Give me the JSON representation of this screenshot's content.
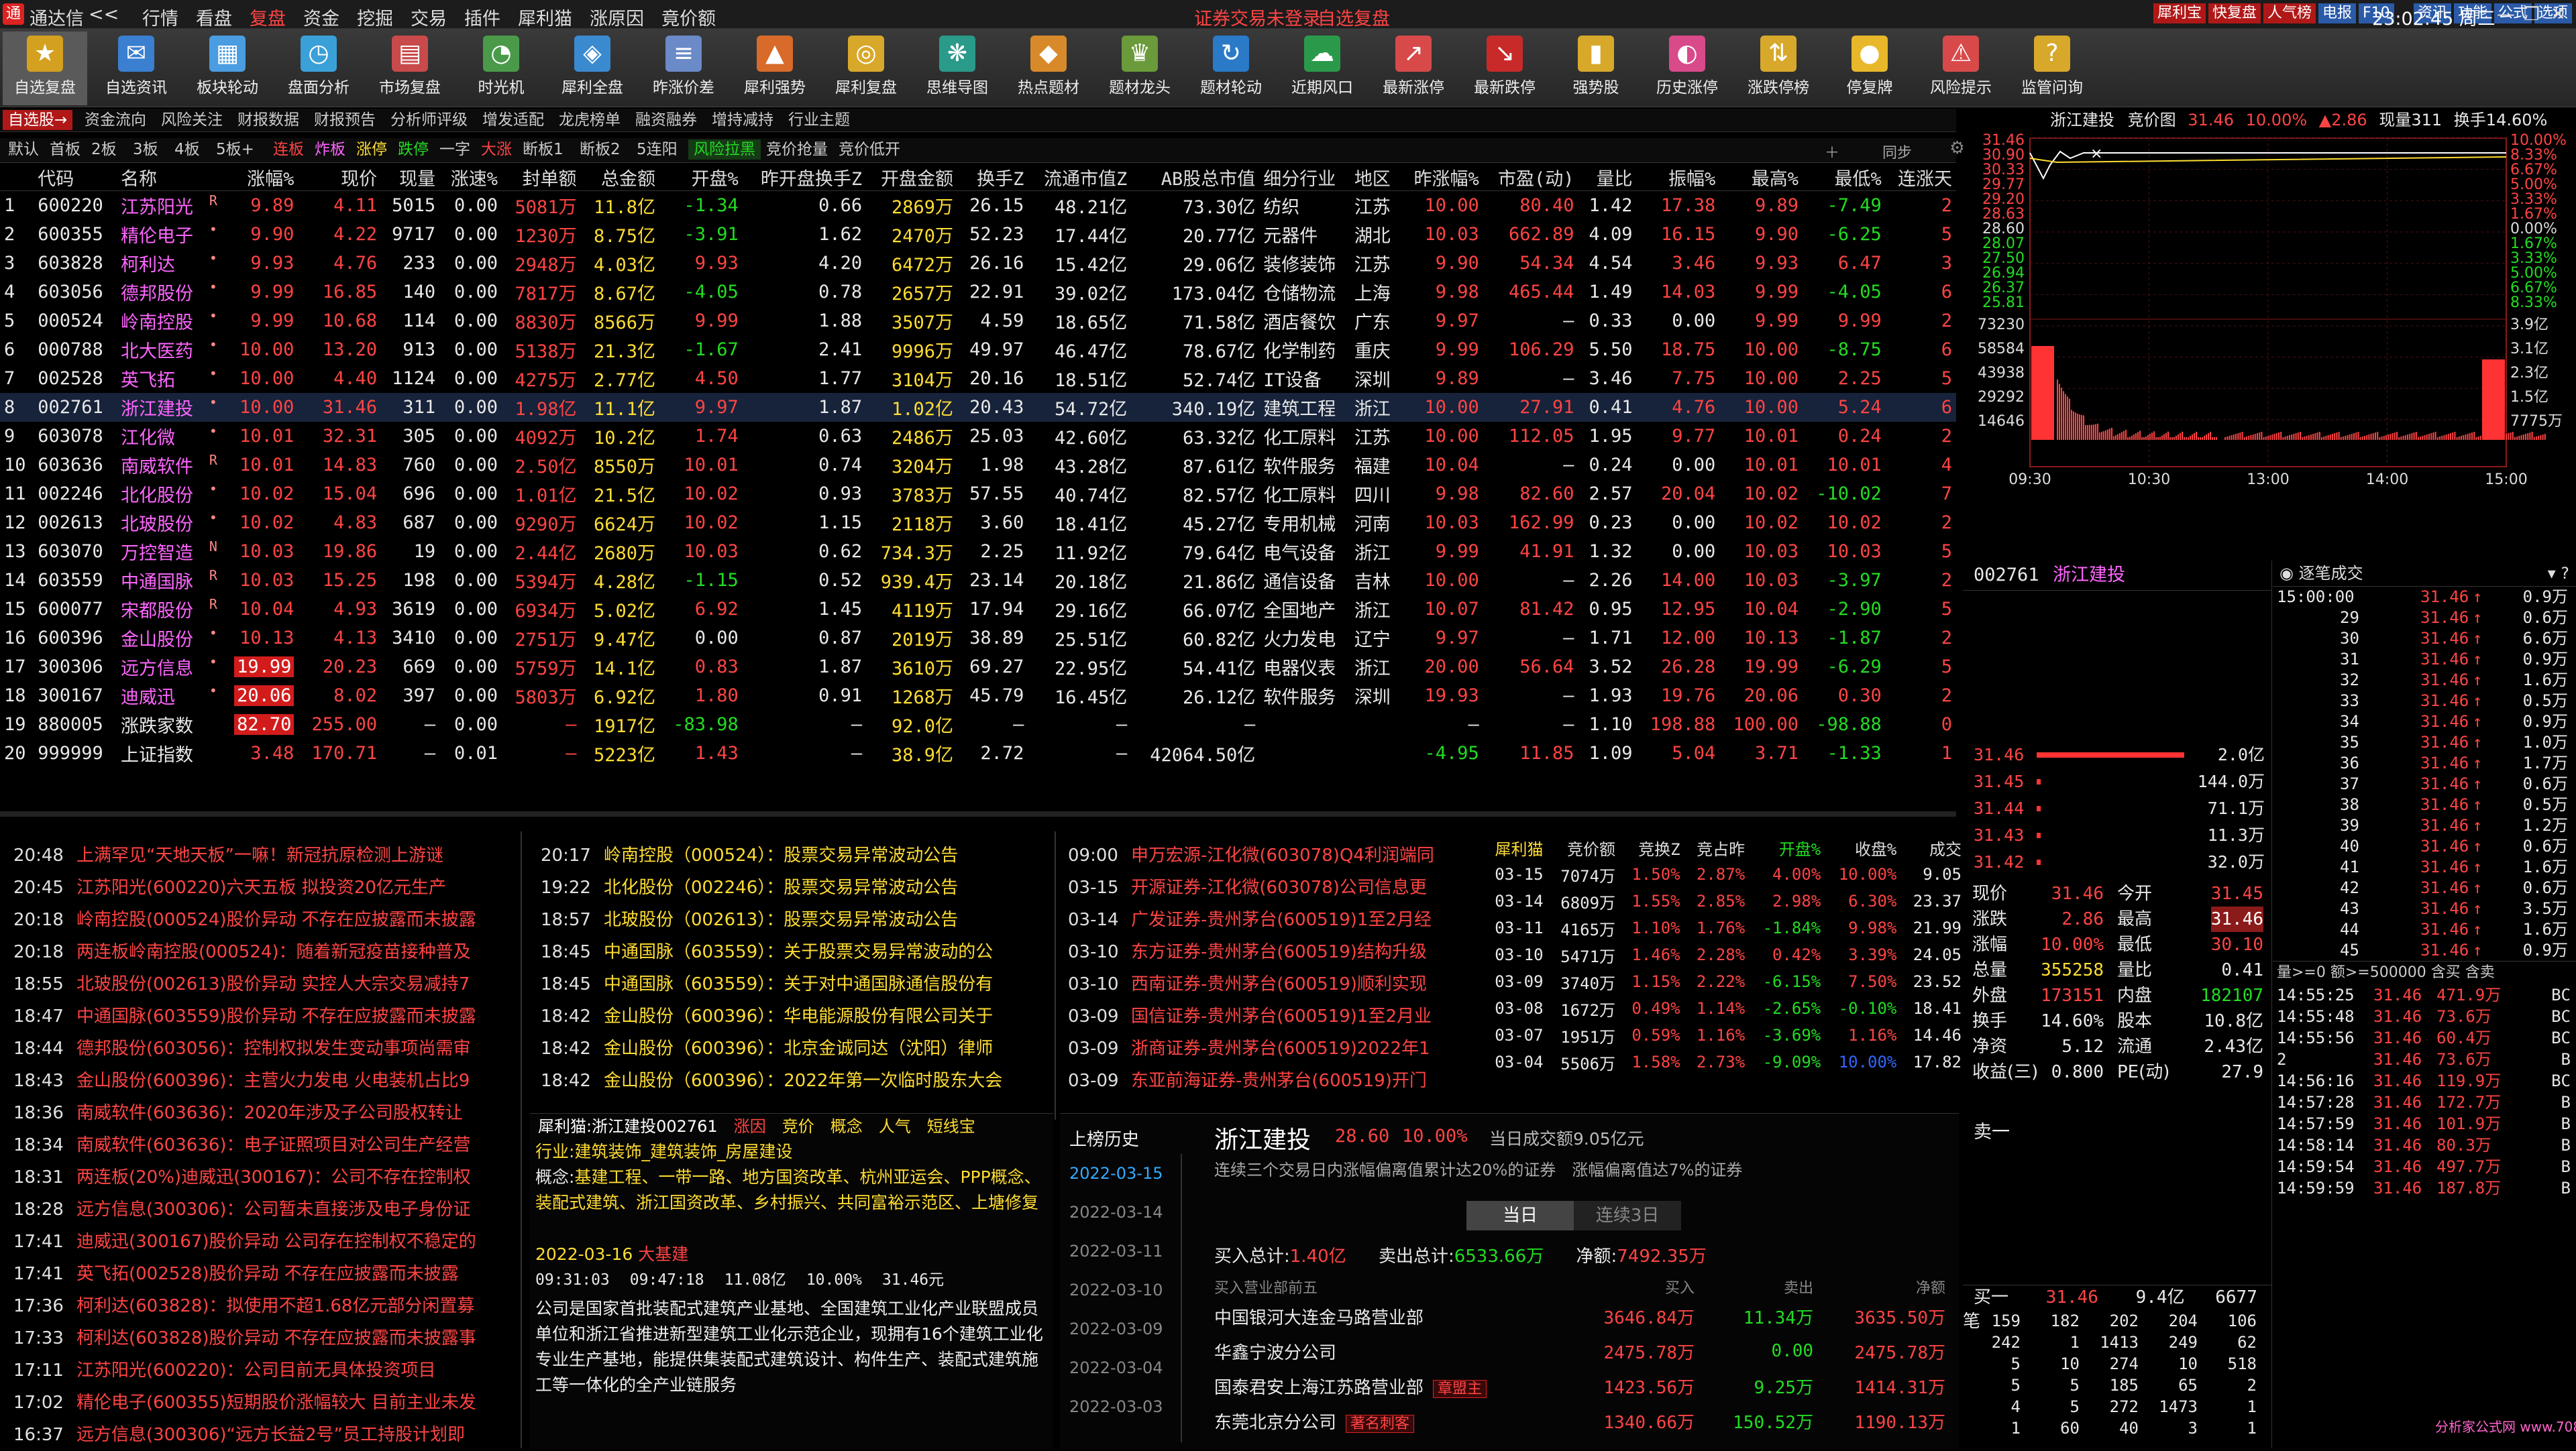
{
  "app": {
    "name": "通达信",
    "nav_back": "<<",
    "menu": [
      "行情",
      "看盘",
      "复盘",
      "资金",
      "挖掘",
      "交易",
      "插件",
      "犀利猫",
      "涨原因",
      "竟价额"
    ],
    "active_menu": "复盘",
    "center_notice": "证券交易未登录",
    "center_link": "自选复盘",
    "right_pills": [
      "犀利宝",
      "快复盘",
      "人气榜",
      "电报",
      "F10",
      "资讯",
      "功能",
      "公式",
      "选项"
    ],
    "clock": "23:02:45 周三"
  },
  "toolbar": [
    "自选复盘",
    "自选资讯",
    "板块轮动",
    "盘面分析",
    "市场复盘",
    "时光机",
    "犀利全盘",
    "昨涨价差",
    "犀利强势",
    "犀利复盘",
    "思维导图",
    "热点题材",
    "题材龙头",
    "题材轮动",
    "近期风口",
    "最新涨停",
    "最新跌停",
    "强势股",
    "历史涨停",
    "涨跌停榜",
    "停复牌",
    "风险提示",
    "监管问询"
  ],
  "tabs1": [
    "自选股→",
    "资金流向",
    "风险关注",
    "财报数据",
    "财报预告",
    "分析师评级",
    "增发适配",
    "龙虎榜单",
    "融资融券",
    "增持减持",
    "行业主题"
  ],
  "tabs2": [
    "默认",
    "首板",
    "2板",
    "3板",
    "4板",
    "5板+",
    "连板",
    "炸板",
    "涨停",
    "跌停",
    "一字",
    "大涨",
    "断板1",
    "断板2",
    "5连阳",
    "风险拉黑",
    "竞价抢量",
    "竞价低开"
  ],
  "sync_label": "同步",
  "columns": [
    "代码",
    "名称",
    "涨幅%",
    "现价",
    "现量",
    "涨速%",
    "封单额",
    "总金额",
    "开盘%",
    "昨开盘换手Z",
    "开盘金额",
    "换手Z",
    "流通市值Z",
    "AB股总市值",
    "细分行业",
    "地区",
    "昨涨幅%",
    "市盈(动)",
    "量比",
    "振幅%",
    "最高%",
    "最低%",
    "连涨天"
  ],
  "rows": [
    [
      "1",
      "600220",
      "江苏阳光",
      "R",
      "9.89",
      "4.11",
      "5015",
      "0.00",
      "5081万",
      "11.8亿",
      "-1.34",
      "0.66",
      "2869万",
      "26.15",
      "48.21亿",
      "73.30亿",
      "纺织",
      "江苏",
      "10.00",
      "80.40",
      "1.42",
      "17.38",
      "9.89",
      "-7.49",
      "2"
    ],
    [
      "2",
      "600355",
      "精伦电子",
      "•",
      "9.90",
      "4.22",
      "9717",
      "0.00",
      "1230万",
      "8.75亿",
      "-3.91",
      "1.62",
      "2470万",
      "52.23",
      "17.44亿",
      "20.77亿",
      "元器件",
      "湖北",
      "10.03",
      "662.89",
      "4.09",
      "16.15",
      "9.90",
      "-6.25",
      "5"
    ],
    [
      "3",
      "603828",
      "柯利达",
      "•",
      "9.93",
      "4.76",
      "233",
      "0.00",
      "2948万",
      "4.03亿",
      "9.93",
      "4.20",
      "6472万",
      "26.16",
      "15.42亿",
      "29.06亿",
      "装修装饰",
      "江苏",
      "9.90",
      "54.34",
      "4.54",
      "3.46",
      "9.93",
      "6.47",
      "3"
    ],
    [
      "4",
      "603056",
      "德邦股份",
      "•",
      "9.99",
      "16.85",
      "140",
      "0.00",
      "7817万",
      "8.67亿",
      "-4.05",
      "0.78",
      "2657万",
      "22.91",
      "39.02亿",
      "173.04亿",
      "仓储物流",
      "上海",
      "9.98",
      "465.44",
      "1.49",
      "14.03",
      "9.99",
      "-4.05",
      "6"
    ],
    [
      "5",
      "000524",
      "岭南控股",
      "•",
      "9.99",
      "10.68",
      "114",
      "0.00",
      "8830万",
      "8566万",
      "9.99",
      "1.88",
      "3507万",
      "4.59",
      "18.65亿",
      "71.58亿",
      "酒店餐饮",
      "广东",
      "9.97",
      "—",
      "0.33",
      "0.00",
      "9.99",
      "9.99",
      "2"
    ],
    [
      "6",
      "000788",
      "北大医药",
      "•",
      "10.00",
      "13.20",
      "913",
      "0.00",
      "5138万",
      "21.3亿",
      "-1.67",
      "2.41",
      "9996万",
      "49.97",
      "46.47亿",
      "78.67亿",
      "化学制药",
      "重庆",
      "9.99",
      "106.29",
      "5.50",
      "18.75",
      "10.00",
      "-8.75",
      "6"
    ],
    [
      "7",
      "002528",
      "英飞拓",
      "•",
      "10.00",
      "4.40",
      "1124",
      "0.00",
      "4275万",
      "2.77亿",
      "4.50",
      "1.77",
      "3104万",
      "20.16",
      "18.51亿",
      "52.74亿",
      "IT设备",
      "深圳",
      "9.89",
      "—",
      "3.46",
      "7.75",
      "10.00",
      "2.25",
      "5"
    ],
    [
      "8",
      "002761",
      "浙江建投",
      "•",
      "10.00",
      "31.46",
      "311",
      "0.00",
      "1.98亿",
      "11.1亿",
      "9.97",
      "1.87",
      "1.02亿",
      "20.43",
      "54.72亿",
      "340.19亿",
      "建筑工程",
      "浙江",
      "10.00",
      "27.91",
      "0.41",
      "4.76",
      "10.00",
      "5.24",
      "6"
    ],
    [
      "9",
      "603078",
      "江化微",
      "•",
      "10.01",
      "32.31",
      "305",
      "0.00",
      "4092万",
      "10.2亿",
      "1.74",
      "0.63",
      "2486万",
      "25.03",
      "42.60亿",
      "63.32亿",
      "化工原料",
      "江苏",
      "10.00",
      "112.05",
      "1.95",
      "9.77",
      "10.01",
      "0.24",
      "2"
    ],
    [
      "10",
      "603636",
      "南威软件",
      "R",
      "10.01",
      "14.83",
      "760",
      "0.00",
      "2.50亿",
      "8550万",
      "10.01",
      "0.74",
      "3204万",
      "1.98",
      "43.28亿",
      "87.61亿",
      "软件服务",
      "福建",
      "10.04",
      "—",
      "0.24",
      "0.00",
      "10.01",
      "10.01",
      "4"
    ],
    [
      "11",
      "002246",
      "北化股份",
      "•",
      "10.02",
      "15.04",
      "696",
      "0.00",
      "1.01亿",
      "21.5亿",
      "10.02",
      "0.93",
      "3783万",
      "57.55",
      "40.74亿",
      "82.57亿",
      "化工原料",
      "四川",
      "9.98",
      "82.60",
      "2.57",
      "20.04",
      "10.02",
      "-10.02",
      "7"
    ],
    [
      "12",
      "002613",
      "北玻股份",
      "•",
      "10.02",
      "4.83",
      "687",
      "0.00",
      "9290万",
      "6624万",
      "10.02",
      "1.15",
      "2118万",
      "3.60",
      "18.41亿",
      "45.27亿",
      "专用机械",
      "河南",
      "10.03",
      "162.99",
      "0.23",
      "0.00",
      "10.02",
      "10.02",
      "2"
    ],
    [
      "13",
      "603070",
      "万控智造",
      "N",
      "10.03",
      "19.86",
      "19",
      "0.00",
      "2.44亿",
      "2680万",
      "10.03",
      "0.62",
      "734.3万",
      "2.25",
      "11.92亿",
      "79.64亿",
      "电气设备",
      "浙江",
      "9.99",
      "41.91",
      "1.32",
      "0.00",
      "10.03",
      "10.03",
      "5"
    ],
    [
      "14",
      "603559",
      "中通国脉",
      "R",
      "10.03",
      "15.25",
      "198",
      "0.00",
      "5394万",
      "4.28亿",
      "-1.15",
      "0.52",
      "939.4万",
      "23.14",
      "20.18亿",
      "21.86亿",
      "通信设备",
      "吉林",
      "10.00",
      "—",
      "2.26",
      "14.00",
      "10.03",
      "-3.97",
      "2"
    ],
    [
      "15",
      "600077",
      "宋都股份",
      "R",
      "10.04",
      "4.93",
      "3619",
      "0.00",
      "6934万",
      "5.02亿",
      "6.92",
      "1.45",
      "4119万",
      "17.94",
      "29.16亿",
      "66.07亿",
      "全国地产",
      "浙江",
      "10.07",
      "81.42",
      "0.95",
      "12.95",
      "10.04",
      "-2.90",
      "5"
    ],
    [
      "16",
      "600396",
      "金山股份",
      "•",
      "10.13",
      "4.13",
      "3410",
      "0.00",
      "2751万",
      "9.47亿",
      "0.00",
      "0.87",
      "2019万",
      "38.89",
      "25.51亿",
      "60.82亿",
      "火力发电",
      "辽宁",
      "9.97",
      "—",
      "1.71",
      "12.00",
      "10.13",
      "-1.87",
      "2"
    ],
    [
      "17",
      "300306",
      "远方信息",
      "•",
      "19.99",
      "20.23",
      "669",
      "0.00",
      "5759万",
      "14.1亿",
      "0.83",
      "1.87",
      "3610万",
      "69.27",
      "22.95亿",
      "54.41亿",
      "电器仪表",
      "浙江",
      "20.00",
      "56.64",
      "3.52",
      "26.28",
      "19.99",
      "-6.29",
      "5"
    ],
    [
      "18",
      "300167",
      "迪威迅",
      "•",
      "20.06",
      "8.02",
      "397",
      "0.00",
      "5803万",
      "6.92亿",
      "1.80",
      "0.91",
      "1268万",
      "45.79",
      "16.45亿",
      "26.12亿",
      "软件服务",
      "深圳",
      "19.93",
      "—",
      "1.93",
      "19.76",
      "20.06",
      "0.30",
      "2"
    ],
    [
      "19",
      "880005",
      "涨跌家数",
      "",
      "82.70",
      "255.00",
      "—",
      "0.00",
      "—",
      "1917亿",
      "-83.98",
      "—",
      "92.0亿",
      "—",
      "—",
      "—",
      "",
      "",
      "—",
      "—",
      "1.10",
      "198.88",
      "100.00",
      "-98.88",
      "0"
    ],
    [
      "20",
      "999999",
      "上证指数",
      "",
      "3.48",
      "170.71",
      "—",
      "0.01",
      "—",
      "5223亿",
      "1.43",
      "—",
      "38.9亿",
      "2.72",
      "—",
      "42064.50亿",
      "",
      "",
      "-4.95",
      "11.85",
      "1.09",
      "5.04",
      "3.71",
      "-1.33",
      "1"
    ]
  ],
  "news1": [
    [
      "20:48",
      "上满罕见“天地天板”一嘛！新冠抗原检测上游谜"
    ],
    [
      "20:45",
      "江苏阳光(600220)六天五板 拟投资20亿元生产"
    ],
    [
      "20:18",
      "岭南控股(000524)股价异动 不存在应披露而未披露"
    ],
    [
      "20:18",
      "两连板岭南控股(000524)：随着新冠疫苗接种普及"
    ],
    [
      "18:55",
      "北玻股份(002613)股价异动 实控人大宗交易减持7"
    ],
    [
      "18:47",
      "中通国脉(603559)股价异动 不存在应披露而未披露"
    ],
    [
      "18:44",
      "德邦股份(603056)：控制权拟发生变动事项尚需审"
    ],
    [
      "18:43",
      "金山股份(600396)：主营火力发电 火电装机占比9"
    ],
    [
      "18:36",
      "南威软件(603636)：2020年涉及子公司股权转让"
    ],
    [
      "18:34",
      "南威软件(603636)：电子证照项目对公司生产经营"
    ],
    [
      "18:31",
      "两连板(20%)迪威迅(300167)：公司不存在控制权"
    ],
    [
      "18:28",
      "远方信息(300306)：公司暂未直接涉及电子身份证"
    ],
    [
      "17:41",
      "迪威迅(300167)股价异动 公司存在控制权不稳定的"
    ],
    [
      "17:41",
      "英飞拓(002528)股价异动 不存在应披露而未披露"
    ],
    [
      "17:36",
      "柯利达(603828)：拟使用不超1.68亿元部分闲置募"
    ],
    [
      "17:33",
      "柯利达(603828)股价异动 不存在应披露而未披露事"
    ],
    [
      "17:11",
      "江苏阳光(600220)：公司目前无具体投资项目"
    ],
    [
      "17:02",
      "精伦电子(600355)短期股价涨幅较大 目前主业未发"
    ],
    [
      "16:37",
      "远方信息(300306)“远方长益2号”员工持股计划即"
    ]
  ],
  "news2": [
    [
      "20:17",
      "岭南控股（000524）：股票交易异常波动公告"
    ],
    [
      "19:22",
      "北化股份（002246）：股票交易异常波动公告"
    ],
    [
      "18:57",
      "北玻股份（002613）：股票交易异常波动公告"
    ],
    [
      "18:45",
      "中通国脉（603559）：关于股票交易异常波动的公"
    ],
    [
      "18:45",
      "中通国脉（603559）：关于对中通国脉通信股份有"
    ],
    [
      "18:42",
      "金山股份（600396）：华电能源股份有限公司关于"
    ],
    [
      "18:42",
      "金山股份（600396）：北京金诚同达（沈阳）律师"
    ],
    [
      "18:42",
      "金山股份（600396）：2022年第一次临时股东大会"
    ]
  ],
  "news3": [
    [
      "09:00",
      "申万宏源-江化微(603078)Q4利润端同"
    ],
    [
      "03-15",
      "开源证券-江化微(603078)公司信息更"
    ],
    [
      "03-14",
      "广发证券-贵州茅台(600519)1至2月经"
    ],
    [
      "03-10",
      "东方证券-贵州茅台(600519)结构升级"
    ],
    [
      "03-10",
      "西南证券-贵州茅台(600519)顺利实现"
    ],
    [
      "03-09",
      "国信证券-贵州茅台(600519)1至2月业"
    ],
    [
      "03-09",
      "浙商证券-贵州茅台(600519)2022年1"
    ],
    [
      "03-09",
      "东亚前海证券-贵州茅台(600519)开门"
    ]
  ],
  "auction": {
    "columns": [
      "犀利猫",
      "竞价额",
      "竞换Z",
      "竞占昨",
      "开盘%",
      "收盘%",
      "成交"
    ],
    "rows": [
      [
        "03-15",
        "7074万",
        "1.50%",
        "2.87%",
        "4.00%",
        "10.00%",
        "9.05"
      ],
      [
        "03-14",
        "6809万",
        "1.55%",
        "2.85%",
        "2.98%",
        "6.30%",
        "23.37"
      ],
      [
        "03-11",
        "4165万",
        "1.10%",
        "1.76%",
        "-1.84%",
        "9.98%",
        "21.99"
      ],
      [
        "03-10",
        "5471万",
        "1.46%",
        "2.28%",
        "0.42%",
        "3.39%",
        "24.05"
      ],
      [
        "03-09",
        "3740万",
        "1.15%",
        "2.22%",
        "-6.15%",
        "7.50%",
        "23.52"
      ],
      [
        "03-08",
        "1672万",
        "0.49%",
        "1.14%",
        "-2.65%",
        "-0.10%",
        "18.41"
      ],
      [
        "03-07",
        "1951万",
        "0.59%",
        "1.16%",
        "-3.69%",
        "1.16%",
        "14.46"
      ],
      [
        "03-04",
        "5506万",
        "1.58%",
        "2.73%",
        "-9.09%",
        "10.00%",
        "17.82"
      ]
    ]
  },
  "concept": {
    "tabs": [
      "犀利猫:浙江建投002761",
      "涨因",
      "竞价",
      "概念",
      "人气",
      "短线宝"
    ],
    "industry_label": "行业:",
    "industry": "建筑装饰_建筑装饰_房屋建设",
    "concept_label": "概念:",
    "concepts": "基建工程、一带一路、地方国资改革、杭州亚运会、PPP概念、装配式建筑、浙江国资改革、乡村振兴、共同富裕示范区、上塘修复",
    "date": "2022-03-16",
    "tag": "大基建",
    "times": [
      "09:31:03",
      "09:47:18",
      "11.08亿",
      "10.00%",
      "31.46元"
    ],
    "desc": "公司是国家首批装配式建筑产业基地、全国建筑工业化产业联盟成员单位和浙江省推进新型建筑工业化示范企业，现拥有16个建筑工业化专业生产基地，能提供集装配式建筑设计、构件生产、装配式建筑施工等一体化的全产业链服务"
  },
  "lhb": {
    "history_label": "上榜历史",
    "dates": [
      "2022-03-15",
      "2022-03-14",
      "2022-03-11",
      "2022-03-10",
      "2022-03-09",
      "2022-03-04",
      "2022-03-03"
    ],
    "stock": "浙江建投",
    "price": "28.60",
    "pct": "10.00%",
    "turnover": "当日成交额9.05亿元",
    "reason": "连续三个交易日内涨幅偏离值累计达20%的证券　涨幅偏离值达7%的证券",
    "tab_today": "当日",
    "tab_3d": "连续3日",
    "buy_total_label": "买入总计:",
    "buy_total": "1.40亿",
    "sell_total_label": "卖出总计:",
    "sell_total": "6533.66万",
    "net_label": "净额:",
    "net": "7492.35万",
    "cols": [
      "买入营业部前五",
      "买入",
      "卖出",
      "净额"
    ],
    "rows": [
      [
        "中国银河大连金马路营业部",
        "3646.84万",
        "11.34万",
        "3635.50万",
        ""
      ],
      [
        "华鑫宁波分公司",
        "2475.78万",
        "0.00",
        "2475.78万",
        ""
      ],
      [
        "国泰君安上海江苏路营业部",
        "1423.56万",
        "9.25万",
        "1414.31万",
        "章盟主"
      ],
      [
        "东莞北京分公司",
        "1340.66万",
        "150.52万",
        "1190.13万",
        "著名刺客"
      ]
    ]
  },
  "chart": {
    "tab": "浙江建投",
    "label": "竞价图",
    "price": "31.46",
    "pct": "10.00%",
    "chg": "▲2.86",
    "vol_label": "现量",
    "vol": "311",
    "hs_label": "换手",
    "hs": "14.60%",
    "y_left": [
      "31.46",
      "30.90",
      "30.33",
      "29.77",
      "29.20",
      "28.63",
      "28.60",
      "28.07",
      "27.50",
      "26.94",
      "26.37",
      "25.81"
    ],
    "y_right": [
      "10.00%",
      "8.33%",
      "6.67%",
      "5.00%",
      "3.33%",
      "1.67%",
      "0.00%",
      "1.67%",
      "3.33%",
      "5.00%",
      "6.67%",
      "8.33%"
    ],
    "vol_left": [
      "73230",
      "58584",
      "43938",
      "29292",
      "14646"
    ],
    "vol_right": [
      "3.9亿",
      "3.1亿",
      "2.3亿",
      "1.5亿",
      "7775万"
    ],
    "x": [
      "09:30",
      "10:30",
      "13:00",
      "14:00",
      "15:00"
    ]
  },
  "quote": {
    "code": "002761",
    "name": "浙江建投",
    "panel_title": "逐笔成交",
    "orders": [
      [
        "31.46",
        "2.0亿"
      ],
      [
        "31.45",
        "144.0万"
      ],
      [
        "31.44",
        "71.1万"
      ],
      [
        "31.43",
        "11.3万"
      ],
      [
        "31.42",
        "32.0万"
      ]
    ],
    "fields": [
      [
        "现价",
        "31.46",
        "今开",
        "31.45"
      ],
      [
        "涨跌",
        "2.86",
        "最高",
        "31.46"
      ],
      [
        "涨幅",
        "10.00%",
        "最低",
        "30.10"
      ],
      [
        "总量",
        "355258",
        "量比",
        "0.41"
      ],
      [
        "外盘",
        "173151",
        "内盘",
        "182107"
      ],
      [
        "换手",
        "14.60%",
        "股本",
        "10.8亿"
      ],
      [
        "净资",
        "5.12",
        "流通",
        "2.43亿"
      ],
      [
        "收益(三)",
        "0.800",
        "PE(动)",
        "27.9"
      ]
    ],
    "sell1": "卖一",
    "buy1": "买一",
    "buy1_price": "31.46",
    "buy1_vol": "9.4亿",
    "buy1_cnt": "6677笔",
    "queue": [
      [
        "159",
        "182",
        "202",
        "204",
        "106"
      ],
      [
        "242",
        "1",
        "1413",
        "249",
        "62"
      ],
      [
        "5",
        "10",
        "274",
        "10",
        "518"
      ],
      [
        "5",
        "5",
        "185",
        "65",
        "2"
      ],
      [
        "4",
        "5",
        "272",
        "1473",
        "1"
      ],
      [
        "1",
        "60",
        "40",
        "3",
        "1"
      ]
    ]
  },
  "ticks": {
    "top": [
      [
        "15:00:00",
        "31.46",
        "0.9万"
      ],
      [
        "29",
        "31.46",
        "0.6万"
      ],
      [
        "30",
        "31.46",
        "6.6万"
      ],
      [
        "31",
        "31.46",
        "0.9万"
      ],
      [
        "32",
        "31.46",
        "1.6万"
      ],
      [
        "33",
        "31.46",
        "0.5万"
      ],
      [
        "34",
        "31.46",
        "0.9万"
      ],
      [
        "35",
        "31.46",
        "1.0万"
      ],
      [
        "36",
        "31.46",
        "1.7万"
      ],
      [
        "37",
        "31.46",
        "0.6万"
      ],
      [
        "38",
        "31.46",
        "0.5万"
      ],
      [
        "39",
        "31.46",
        "1.2万"
      ],
      [
        "40",
        "31.46",
        "0.6万"
      ],
      [
        "41",
        "31.46",
        "1.6万"
      ],
      [
        "42",
        "31.46",
        "0.6万"
      ],
      [
        "43",
        "31.46",
        "3.5万"
      ],
      [
        "44",
        "31.46",
        "1.6万"
      ],
      [
        "45",
        "31.46",
        "0.9万"
      ]
    ],
    "filter": "量>=0 额>=500000 含买 含卖",
    "big": [
      [
        "14:55:25",
        "31.46",
        "471.9万",
        "BC"
      ],
      [
        "14:55:48",
        "31.46",
        "73.6万",
        "BC"
      ],
      [
        "14:55:56",
        "31.46",
        "60.4万",
        "BC"
      ],
      [
        "2",
        "31.46",
        "73.6万",
        "B"
      ],
      [
        "14:56:16",
        "31.46",
        "119.9万",
        "BC"
      ],
      [
        "14:57:28",
        "31.46",
        "172.7万",
        "B"
      ],
      [
        "14:57:59",
        "31.46",
        "101.9万",
        "B"
      ],
      [
        "14:58:14",
        "31.46",
        "80.3万",
        "B"
      ],
      [
        "14:59:54",
        "31.46",
        "497.7万",
        "B"
      ],
      [
        "14:59:59",
        "31.46",
        "187.8万",
        "B"
      ]
    ]
  },
  "watermark": "分析家公式网 www.70822.com"
}
